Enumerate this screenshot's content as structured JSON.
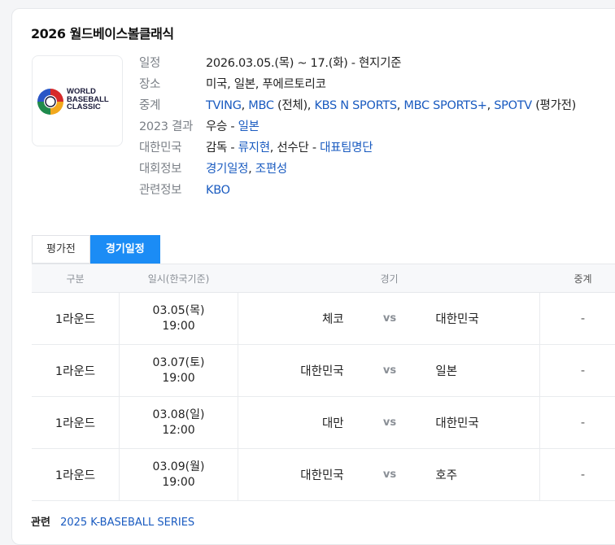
{
  "title": "2026 월드베이스볼클래식",
  "logo": {
    "line1": "WORLD",
    "line2": "BASEBALL",
    "line3": "CLASSIC"
  },
  "info": {
    "schedule_label": "일정",
    "schedule_value": "2026.03.05.(목) ~ 17.(화) - 현지기준",
    "venue_label": "장소",
    "venue_value": "미국, 일본, 푸에르토리코",
    "broadcast_label": "중계",
    "broadcast_tving": "TVING",
    "broadcast_sep1": ", ",
    "broadcast_mbc": "MBC",
    "broadcast_mbc_note": " (전체), ",
    "broadcast_kbsn": "KBS N SPORTS",
    "broadcast_sep2": ", ",
    "broadcast_mbcs": "MBC SPORTS+",
    "broadcast_sep3": ", ",
    "broadcast_spotv": "SPOTV",
    "broadcast_spotv_note": " (평가전)",
    "result_label": "2023 결과",
    "result_prefix": "우승 - ",
    "result_value": "일본",
    "korea_label": "대한민국",
    "korea_coach_prefix": "감독 - ",
    "korea_coach": "류지현",
    "korea_roster_prefix": ", 선수단 - ",
    "korea_roster": "대표팀명단",
    "tournament_label": "대회정보",
    "tournament_schedule": "경기일정",
    "tournament_sep": ", ",
    "tournament_groups": "조편성",
    "related_label": "관련정보",
    "related_value": "KBO"
  },
  "tabs": [
    {
      "label": "평가전"
    },
    {
      "label": "경기일정"
    }
  ],
  "table": {
    "headers": [
      "구분",
      "일시(한국기준)",
      "경기",
      "중계"
    ],
    "vs_label": "vs",
    "rows": [
      {
        "round": "1라운드",
        "date": "03.05(목)",
        "time": "19:00",
        "home": "체코",
        "away": "대한민국",
        "broadcast": "-"
      },
      {
        "round": "1라운드",
        "date": "03.07(토)",
        "time": "19:00",
        "home": "대한민국",
        "away": "일본",
        "broadcast": "-"
      },
      {
        "round": "1라운드",
        "date": "03.08(일)",
        "time": "12:00",
        "home": "대만",
        "away": "대한민국",
        "broadcast": "-"
      },
      {
        "round": "1라운드",
        "date": "03.09(월)",
        "time": "19:00",
        "home": "대한민국",
        "away": "호주",
        "broadcast": "-"
      }
    ]
  },
  "footer": {
    "label": "관련",
    "link": "2025 K-BASEBALL SERIES"
  },
  "colors": {
    "accent": "#1b8cf5",
    "link": "#1a5bc0"
  }
}
